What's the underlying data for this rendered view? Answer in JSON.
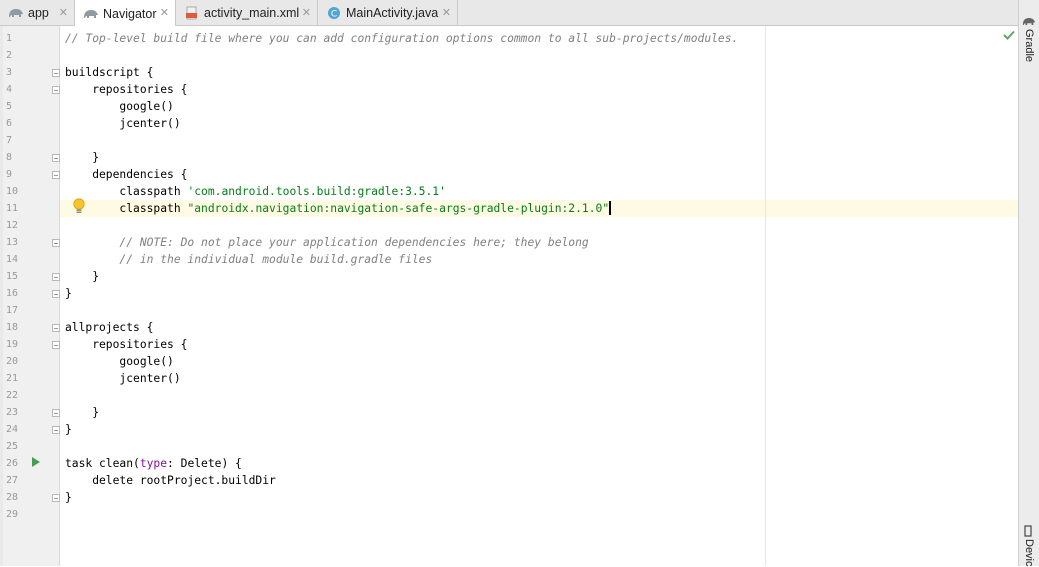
{
  "tabs": [
    {
      "label": "app",
      "icon": "gradle-elephant-icon",
      "active": false
    },
    {
      "label": "Navigator",
      "icon": "gradle-elephant-icon",
      "active": true
    },
    {
      "label": "activity_main.xml",
      "icon": "xml-file-icon",
      "active": false
    },
    {
      "label": "MainActivity.java",
      "icon": "java-class-icon",
      "active": false
    }
  ],
  "tab_close_glyph": "✕",
  "right_tools": [
    {
      "label": "Gradle",
      "icon": "gradle-elephant-icon"
    },
    {
      "label": "Devic",
      "icon": "device-icon"
    }
  ],
  "editor": {
    "caret_line": 11,
    "status_icon": "check-icon",
    "gutter_icons": {
      "bulb_line": 11,
      "run_line": 26
    },
    "lines": [
      {
        "n": "1",
        "seg": [
          {
            "t": "// Top-level build file where you can add configuration options common to all sub-projects/modules.",
            "c": "comment"
          }
        ]
      },
      {
        "n": "2",
        "seg": []
      },
      {
        "n": "3",
        "seg": [
          {
            "t": "buildscript {",
            "c": "plain"
          }
        ]
      },
      {
        "n": "4",
        "seg": [
          {
            "t": "    repositories {",
            "c": "plain"
          }
        ]
      },
      {
        "n": "5",
        "seg": [
          {
            "t": "        google()",
            "c": "plain"
          }
        ]
      },
      {
        "n": "6",
        "seg": [
          {
            "t": "        jcenter()",
            "c": "plain"
          }
        ]
      },
      {
        "n": "7",
        "seg": []
      },
      {
        "n": "8",
        "seg": [
          {
            "t": "    }",
            "c": "plain"
          }
        ]
      },
      {
        "n": "9",
        "seg": [
          {
            "t": "    dependencies {",
            "c": "plain"
          }
        ]
      },
      {
        "n": "10",
        "seg": [
          {
            "t": "        classpath ",
            "c": "plain"
          },
          {
            "t": "'com.android.tools.build:gradle:3.5.1'",
            "c": "string"
          }
        ]
      },
      {
        "n": "11",
        "seg": [
          {
            "t": "        classpath ",
            "c": "plain"
          },
          {
            "t": "\"androidx.navigation:navigation-safe-args-gradle-plugin:2.1.0\"",
            "c": "string"
          }
        ]
      },
      {
        "n": "12",
        "seg": []
      },
      {
        "n": "13",
        "seg": [
          {
            "t": "        // NOTE: Do not place your application dependencies here; they belong",
            "c": "comment"
          }
        ]
      },
      {
        "n": "14",
        "seg": [
          {
            "t": "        // in the individual module build.gradle files",
            "c": "comment"
          }
        ]
      },
      {
        "n": "15",
        "seg": [
          {
            "t": "    }",
            "c": "plain"
          }
        ]
      },
      {
        "n": "16",
        "seg": [
          {
            "t": "}",
            "c": "plain"
          }
        ]
      },
      {
        "n": "17",
        "seg": []
      },
      {
        "n": "18",
        "seg": [
          {
            "t": "allprojects {",
            "c": "plain"
          }
        ]
      },
      {
        "n": "19",
        "seg": [
          {
            "t": "    repositories {",
            "c": "plain"
          }
        ]
      },
      {
        "n": "20",
        "seg": [
          {
            "t": "        google()",
            "c": "plain"
          }
        ]
      },
      {
        "n": "21",
        "seg": [
          {
            "t": "        jcenter()",
            "c": "plain"
          }
        ]
      },
      {
        "n": "22",
        "seg": []
      },
      {
        "n": "23",
        "seg": [
          {
            "t": "    }",
            "c": "plain"
          }
        ]
      },
      {
        "n": "24",
        "seg": [
          {
            "t": "}",
            "c": "plain"
          }
        ]
      },
      {
        "n": "25",
        "seg": []
      },
      {
        "n": "26",
        "seg": [
          {
            "t": "task clean(",
            "c": "plain"
          },
          {
            "t": "type",
            "c": "keyword"
          },
          {
            "t": ": Delete) {",
            "c": "plain"
          }
        ]
      },
      {
        "n": "27",
        "seg": [
          {
            "t": "    delete rootProject.buildDir",
            "c": "plain"
          }
        ]
      },
      {
        "n": "28",
        "seg": [
          {
            "t": "}",
            "c": "plain"
          }
        ]
      },
      {
        "n": "29",
        "seg": []
      }
    ],
    "fold_lines": [
      3,
      4,
      8,
      9,
      13,
      15,
      16,
      18,
      19,
      23,
      24,
      28
    ]
  }
}
